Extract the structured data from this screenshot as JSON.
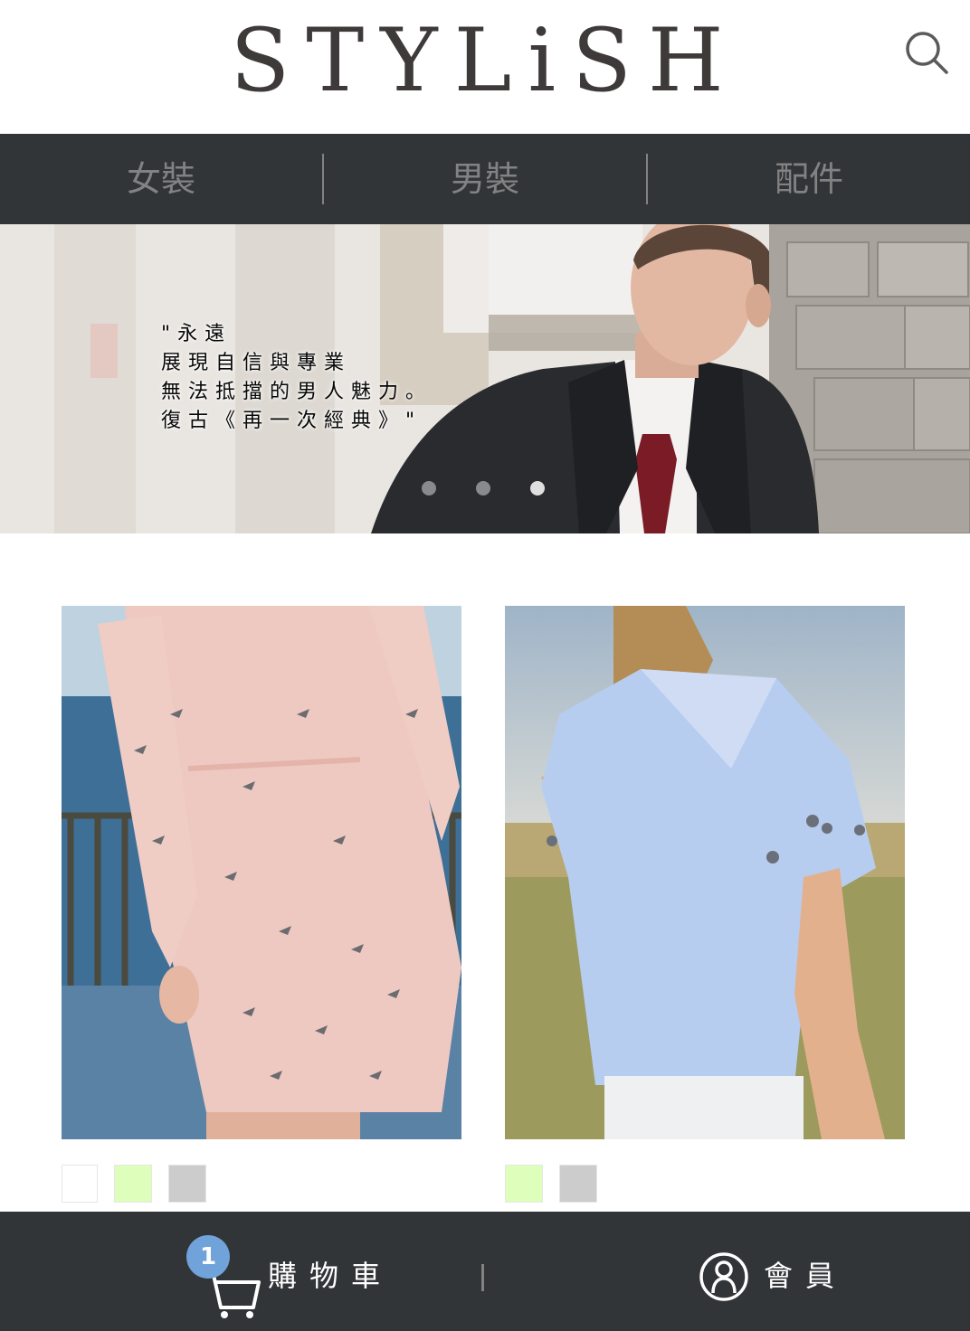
{
  "header": {
    "logo_text": "STYLiSH",
    "search_icon": "search-icon"
  },
  "nav": {
    "items": [
      {
        "label": "女裝"
      },
      {
        "label": "男裝"
      },
      {
        "label": "配件"
      }
    ]
  },
  "hero": {
    "slogan_lines": [
      "\"永遠",
      "展現自信與專業",
      "無法抵擋的男人魅力。",
      "復古《再一次經典》\""
    ],
    "dot_count": 3,
    "active_dot": 2
  },
  "products": [
    {
      "name": "",
      "swatch_colors": [
        "#FFFFFF",
        "#DDFFBB",
        "#CCCCCC"
      ]
    },
    {
      "name": "",
      "swatch_colors": [
        "#DDFFBB",
        "#CCCCCC"
      ]
    }
  ],
  "bottom_bar": {
    "cart_label": "購物車",
    "cart_count": "1",
    "cart_icon": "cart-icon",
    "member_label": "會員",
    "member_icon": "member-icon"
  },
  "colors": {
    "nav_bg": "#313538",
    "nav_text": "#828282",
    "badge": "#6FA3D9",
    "logo": "#3F3A3A"
  }
}
